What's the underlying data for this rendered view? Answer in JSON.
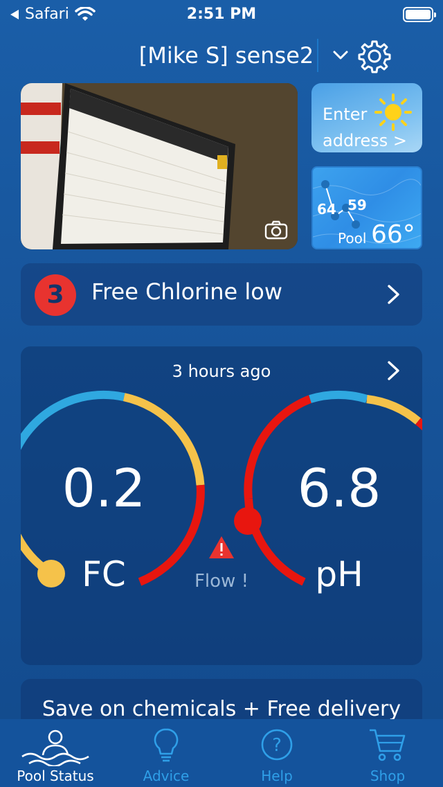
{
  "status_bar": {
    "back_app": "Safari",
    "time": "2:51 PM"
  },
  "header": {
    "device_name": "[Mike S] sense2"
  },
  "weather": {
    "line1": "Enter",
    "line2": "address >"
  },
  "pool": {
    "reading1": "64",
    "reading2": "59",
    "label": "Pool",
    "temperature": "66°"
  },
  "alert": {
    "count": "3",
    "message": "Free Chlorine low"
  },
  "readings": {
    "time_ago": "3 hours ago",
    "fc": {
      "value": "0.2",
      "unit": "FC"
    },
    "ph": {
      "value": "6.8",
      "unit": "pH"
    },
    "flow_text": "Flow !"
  },
  "promo": {
    "text": "Save on chemicals + Free delivery"
  },
  "tabs": [
    {
      "label": "Pool Status"
    },
    {
      "label": "Advice"
    },
    {
      "label": "Help"
    },
    {
      "label": "Shop"
    }
  ],
  "colors": {
    "accent": "#2f9fe8",
    "alert_red": "#e8332f",
    "gauge_yellow": "#f5c24a",
    "gauge_blue": "#2fa8e0",
    "gauge_red": "#e8160f"
  }
}
